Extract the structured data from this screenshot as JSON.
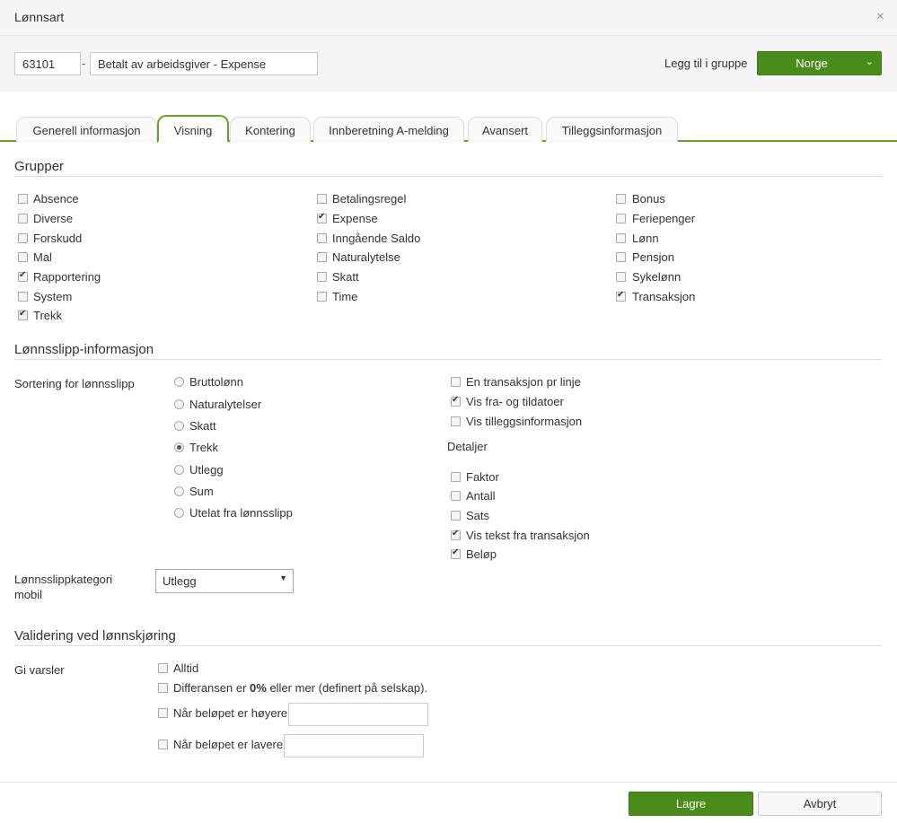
{
  "dialog": {
    "title": "Lønnsart",
    "close_icon": "×"
  },
  "header": {
    "code": "63101",
    "separator": "-",
    "name": "Betalt av arbeidsgiver - Expense",
    "group_label": "Legg til i gruppe",
    "group_value": "Norge",
    "caret": "⌄"
  },
  "tabs": [
    {
      "label": "Generell informasjon"
    },
    {
      "label": "Visning",
      "active": true
    },
    {
      "label": "Kontering"
    },
    {
      "label": "Innberetning A-melding"
    },
    {
      "label": "Avansert"
    },
    {
      "label": "Tilleggsinformasjon"
    }
  ],
  "groups": {
    "title": "Grupper",
    "items": [
      {
        "label": "Absence",
        "checked": false
      },
      {
        "label": "Diverse",
        "checked": false
      },
      {
        "label": "Forskudd",
        "checked": false
      },
      {
        "label": "Mal",
        "checked": false
      },
      {
        "label": "Rapportering",
        "checked": true
      },
      {
        "label": "System",
        "checked": false
      },
      {
        "label": "Trekk",
        "checked": true
      },
      {
        "label": "Betalingsregel",
        "checked": false
      },
      {
        "label": "Expense",
        "checked": true
      },
      {
        "label": "Inngående Saldo",
        "checked": false
      },
      {
        "label": "Naturalytelse",
        "checked": false
      },
      {
        "label": "Skatt",
        "checked": false
      },
      {
        "label": "Time",
        "checked": false
      },
      {
        "label": "Bonus",
        "checked": false
      },
      {
        "label": "Feriepenger",
        "checked": false
      },
      {
        "label": "Lønn",
        "checked": false
      },
      {
        "label": "Pensjon",
        "checked": false
      },
      {
        "label": "Sykelønn",
        "checked": false
      },
      {
        "label": "Transaksjon",
        "checked": true
      }
    ]
  },
  "payslip": {
    "title": "Lønnsslipp-informasjon",
    "sort_label": "Sortering for lønnsslipp",
    "sort_options": [
      {
        "label": "Bruttolønn",
        "selected": false
      },
      {
        "label": "Naturalytelser",
        "selected": false
      },
      {
        "label": "Skatt",
        "selected": false
      },
      {
        "label": "Trekk",
        "selected": true
      },
      {
        "label": "Utlegg",
        "selected": false
      },
      {
        "label": "Sum",
        "selected": false
      },
      {
        "label": "Utelat fra lønnsslipp",
        "selected": false
      }
    ],
    "options": [
      {
        "label": "En transaksjon pr linje",
        "checked": false
      },
      {
        "label": "Vis fra- og tildatoer",
        "checked": true
      },
      {
        "label": "Vis tilleggsinformasjon",
        "checked": false
      }
    ],
    "details_label": "Detaljer",
    "details": [
      {
        "label": "Faktor",
        "checked": false
      },
      {
        "label": "Antall",
        "checked": false
      },
      {
        "label": "Sats",
        "checked": false
      },
      {
        "label": "Vis tekst fra transaksjon",
        "checked": true
      },
      {
        "label": "Beløp",
        "checked": true
      }
    ],
    "mobile_category_label_line1": "Lønnsslippkategori",
    "mobile_category_label_line2": "mobil",
    "mobile_category_value": "Utlegg",
    "mobile_category_caret": "▼"
  },
  "validation": {
    "title": "Validering ved lønnskjøring",
    "warn_label": "Gi varsler",
    "always": "Alltid",
    "diff_before": "Differansen er ",
    "diff_bold": "0%",
    "diff_after": " eller mer (definert på selskap).",
    "higher": "Når beløpet er høyere",
    "higher_value": "",
    "lower": "Når beløpet er lavere",
    "lower_value": ""
  },
  "footer": {
    "save": "Lagre",
    "cancel": "Avbryt"
  }
}
